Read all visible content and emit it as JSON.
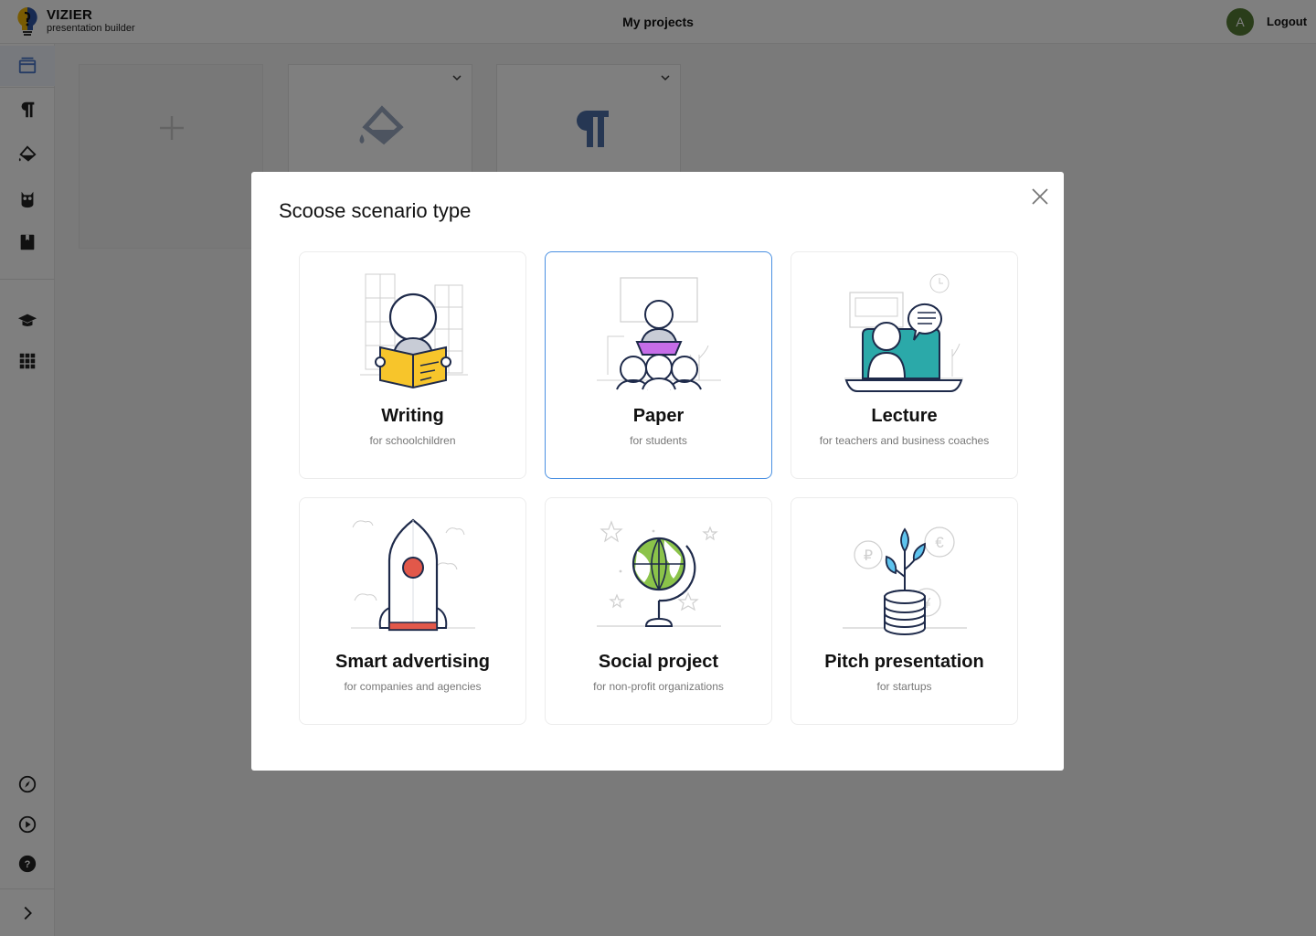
{
  "app": {
    "name": "VIZIER",
    "subtitle": "presentation builder",
    "page_title": "My projects",
    "avatar_initial": "A",
    "logout_label": "Logout"
  },
  "sidebar": {
    "items": [
      {
        "icon": "projects-icon",
        "active": true
      },
      {
        "icon": "paragraph-icon"
      },
      {
        "icon": "paint-bucket-icon"
      },
      {
        "icon": "owl-icon"
      },
      {
        "icon": "book-icon"
      },
      {
        "icon": "graduation-cap-icon"
      },
      {
        "icon": "grid-icon"
      },
      {
        "icon": "compass-icon"
      },
      {
        "icon": "play-icon"
      },
      {
        "icon": "help-icon"
      },
      {
        "icon": "expand-icon"
      }
    ]
  },
  "projects": [
    {
      "icon": "plus-icon"
    },
    {
      "icon": "paint-bucket-icon"
    },
    {
      "icon": "paragraph-icon"
    }
  ],
  "modal": {
    "title": "Scoose scenario type",
    "scenarios": [
      {
        "name": "Writing",
        "subtitle": "for schoolchildren",
        "icon": "reading-person-illustration",
        "accent": "#f7c52b"
      },
      {
        "name": "Paper",
        "subtitle": "for students",
        "icon": "presenter-illustration",
        "accent": "#c66de8",
        "selected": true
      },
      {
        "name": "Lecture",
        "subtitle": "for teachers and business coaches",
        "icon": "lecture-illustration",
        "accent": "#2ba9a9"
      },
      {
        "name": "Smart advertising",
        "subtitle": "for companies and agencies",
        "icon": "rocket-illustration",
        "accent": "#e2584a"
      },
      {
        "name": "Social project",
        "subtitle": "for non-profit organizations",
        "icon": "globe-illustration",
        "accent": "#8bc34a"
      },
      {
        "name": "Pitch presentation",
        "subtitle": "for startups",
        "icon": "money-plant-illustration",
        "accent": "#5ec3ee"
      }
    ]
  },
  "colors": {
    "selection": "#4a90e2",
    "avatar": "#557a35",
    "logo_yellow": "#f2b705",
    "logo_blue": "#2e55a5"
  }
}
